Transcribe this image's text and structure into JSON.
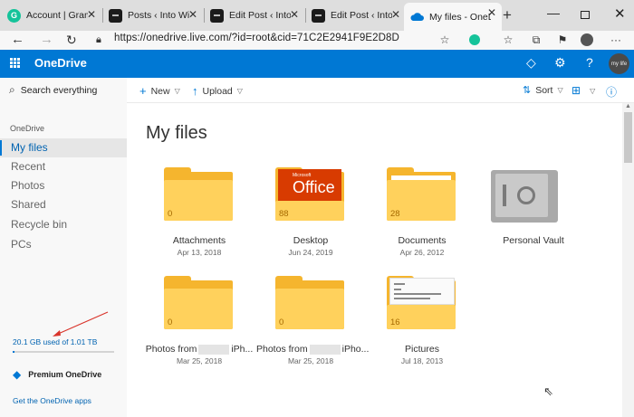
{
  "browser": {
    "tabs": [
      {
        "title": "Account | Gramma",
        "favicon": "grammarly-icon",
        "active": false
      },
      {
        "title": "Posts ‹ Into Windo",
        "favicon": "site-icon",
        "active": false
      },
      {
        "title": "Edit Post ‹ Into W",
        "favicon": "site-icon",
        "active": false
      },
      {
        "title": "Edit Post ‹ Into W",
        "favicon": "site-icon",
        "active": false
      },
      {
        "title": "My files - OneDriv",
        "favicon": "onedrive-cloud-icon",
        "active": true
      }
    ],
    "new_tab": "+",
    "window_controls": {
      "minimize": "—",
      "close": "✕"
    },
    "url": "https://onedrive.live.com/?id=root&cid=71C2E2941F9E2D8D"
  },
  "header": {
    "app_name": "OneDrive",
    "icons": [
      "premium-diamond-icon",
      "settings-gear-icon",
      "help-icon"
    ],
    "help": "?",
    "avatar_text": "my life"
  },
  "sidebar": {
    "search_placeholder": "Search everything",
    "section": "OneDrive",
    "items": [
      {
        "label": "My files",
        "active": true
      },
      {
        "label": "Recent",
        "active": false
      },
      {
        "label": "Photos",
        "active": false
      },
      {
        "label": "Shared",
        "active": false
      },
      {
        "label": "Recycle bin",
        "active": false
      },
      {
        "label": "PCs",
        "active": false
      }
    ],
    "storage_text": "20.1 GB used of 1.01 TB",
    "storage_fraction": 0.02,
    "premium": "Premium OneDrive",
    "get_apps": "Get the OneDrive apps"
  },
  "commandbar": {
    "new_label": "New",
    "upload_label": "Upload",
    "sort_label": "Sort"
  },
  "main": {
    "title": "My files",
    "items": [
      {
        "name": "Attachments",
        "date": "Apr 13, 2018",
        "count": "0",
        "kind": "folder"
      },
      {
        "name": "Desktop",
        "date": "Jun 24, 2019",
        "count": "88",
        "kind": "folder-office",
        "thumb_ms": "Microsoft",
        "thumb_office": "Office"
      },
      {
        "name": "Documents",
        "date": "Apr 26, 2012",
        "count": "28",
        "kind": "folder"
      },
      {
        "name": "Personal Vault",
        "date": "",
        "count": "",
        "kind": "vault"
      },
      {
        "name_prefix": "Photos from",
        "name_suffix": "iPh...",
        "date": "Mar 25, 2018",
        "count": "0",
        "kind": "folder"
      },
      {
        "name_prefix": "Photos from",
        "name_suffix": "iPho...",
        "date": "Mar 25, 2018",
        "count": "0",
        "kind": "folder"
      },
      {
        "name": "Pictures",
        "date": "Jul 18, 2013",
        "count": "16",
        "kind": "folder-doc"
      }
    ]
  },
  "colors": {
    "brand_blue": "#0078d4",
    "folder_front": "#ffd15c",
    "folder_back": "#f5b52e",
    "annotation_arrow": "#d9342b"
  }
}
